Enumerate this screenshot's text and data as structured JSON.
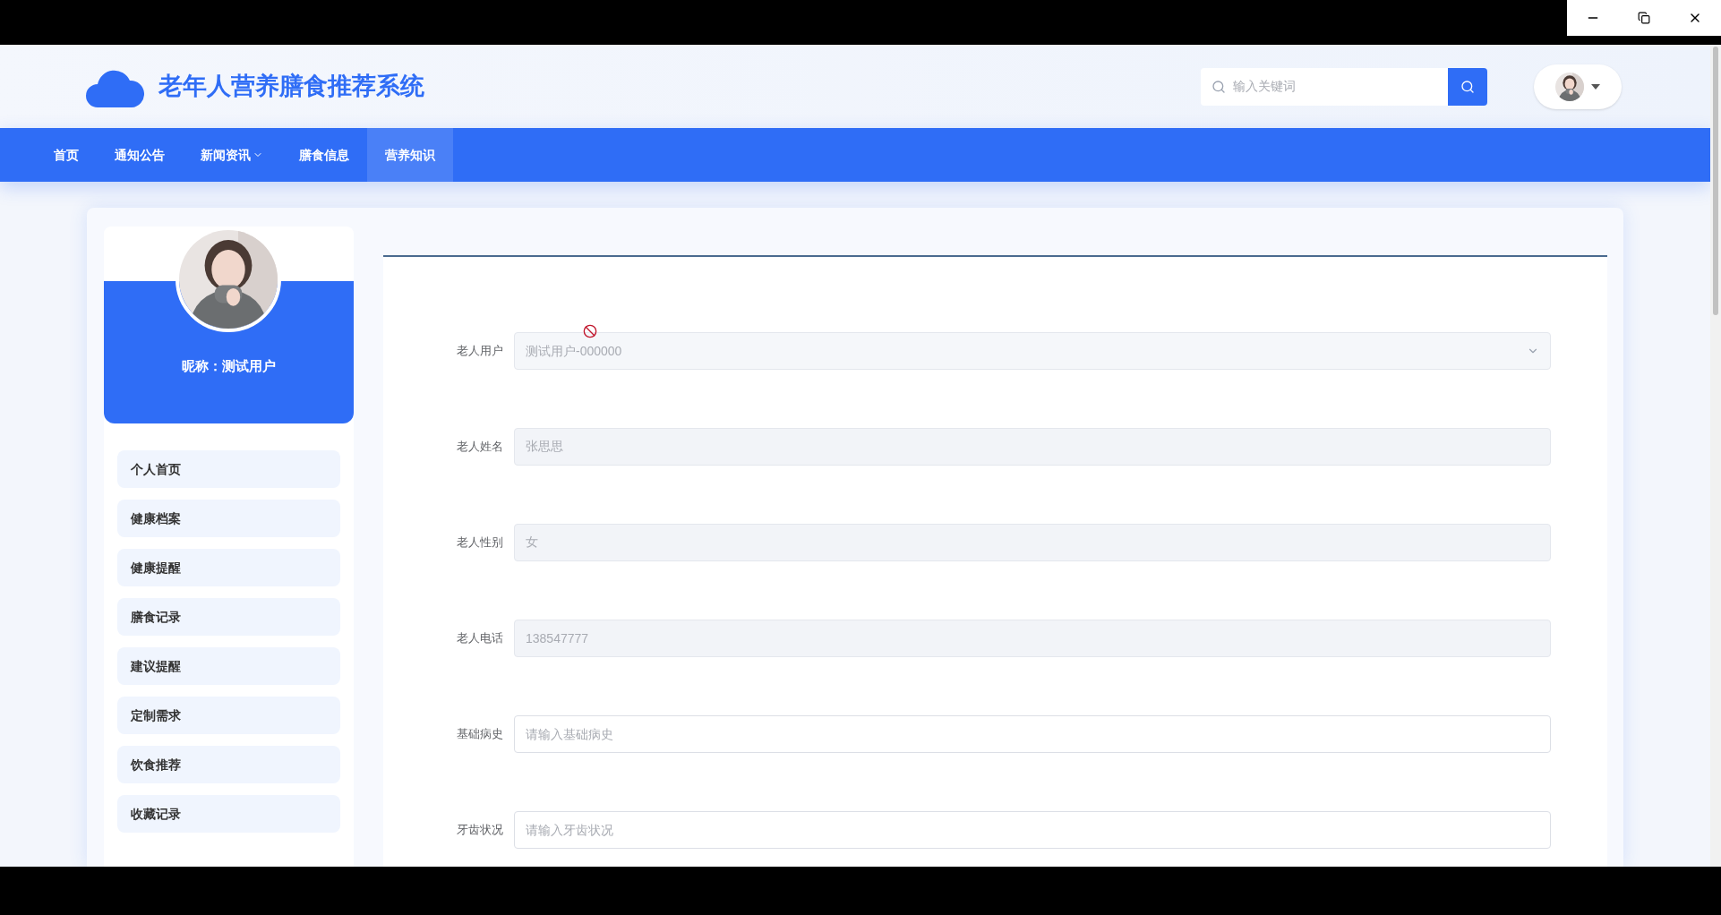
{
  "site": {
    "title": "老年人营养膳食推荐系统"
  },
  "search": {
    "placeholder": "输入关键词"
  },
  "nav": [
    {
      "label": "首页",
      "selected": false,
      "has_dropdown": false
    },
    {
      "label": "通知公告",
      "selected": false,
      "has_dropdown": false
    },
    {
      "label": "新闻资讯",
      "selected": false,
      "has_dropdown": true
    },
    {
      "label": "膳食信息",
      "selected": false,
      "has_dropdown": false
    },
    {
      "label": "营养知识",
      "selected": true,
      "has_dropdown": false
    }
  ],
  "profile": {
    "nickname": "昵称：测试用户"
  },
  "sidebar": {
    "items": [
      {
        "label": "个人首页"
      },
      {
        "label": "健康档案"
      },
      {
        "label": "健康提醒"
      },
      {
        "label": "膳食记录"
      },
      {
        "label": "建议提醒"
      },
      {
        "label": "定制需求"
      },
      {
        "label": "饮食推荐"
      },
      {
        "label": "收藏记录"
      }
    ]
  },
  "form": {
    "fields": [
      {
        "label": "老人用户",
        "kind": "select",
        "value": "测试用户-000000",
        "disabled": true
      },
      {
        "label": "老人姓名",
        "kind": "text",
        "value": "张思思",
        "disabled": true
      },
      {
        "label": "老人性别",
        "kind": "text",
        "value": "女",
        "disabled": true
      },
      {
        "label": "老人电话",
        "kind": "text",
        "value": "138547777",
        "disabled": true
      },
      {
        "label": "基础病史",
        "kind": "text",
        "placeholder": "请输入基础病史",
        "disabled": false
      },
      {
        "label": "牙齿状况",
        "kind": "text",
        "placeholder": "请输入牙齿状况",
        "disabled": false
      }
    ]
  }
}
